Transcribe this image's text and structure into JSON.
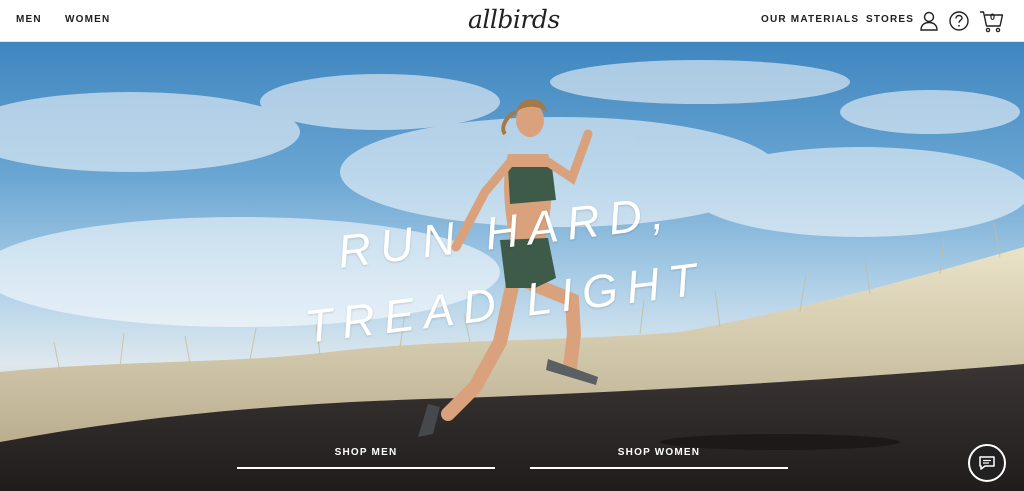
{
  "header": {
    "nav_left": [
      "MEN",
      "WOMEN"
    ],
    "logo": "allbirds",
    "nav_right": [
      "OUR MATERIALS",
      "STORES"
    ],
    "cart_count": "0",
    "icons": [
      "account-icon",
      "help-icon",
      "cart-icon"
    ]
  },
  "hero": {
    "headline_line1": "RUN HARD,",
    "headline_line2": "TREAD LIGHT",
    "cta_men": "SHOP MEN",
    "cta_women": "SHOP WOMEN"
  },
  "chat": {
    "icon": "chat-icon"
  },
  "colors": {
    "text_dark": "#212121",
    "sky": "#5d9cce",
    "grass": "#d9cfb0",
    "sand": "#2f2b29",
    "outfit": "#3e5a48"
  }
}
